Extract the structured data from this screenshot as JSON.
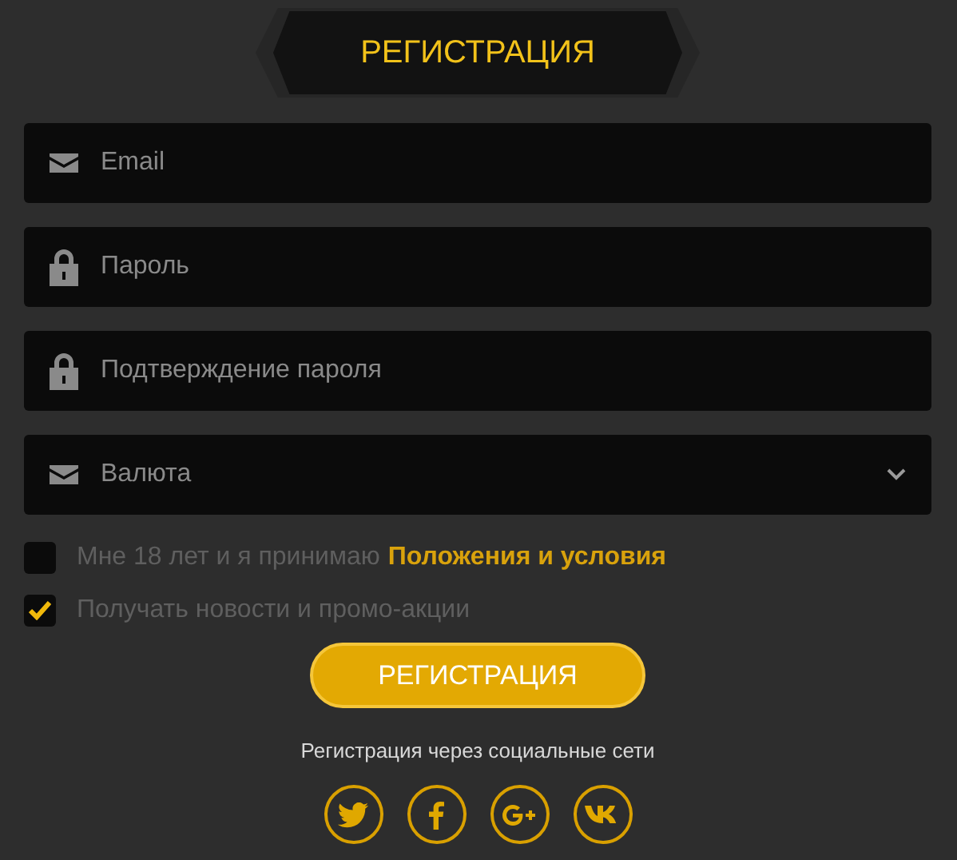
{
  "header": {
    "title": "РЕГИСТРАЦИЯ"
  },
  "fields": [
    {
      "kind": "email",
      "placeholder": "Email"
    },
    {
      "kind": "password",
      "placeholder": "Пароль"
    },
    {
      "kind": "password",
      "placeholder": "Подтверждение пароля"
    },
    {
      "kind": "currency",
      "placeholder": "Валюта"
    }
  ],
  "checkboxes": [
    {
      "label": "Мне 18 лет и я принимаю",
      "link": "Положения и условия",
      "checked": false
    },
    {
      "label": "Получать новости и промо-акции",
      "checked": true
    }
  ],
  "submit": "РЕГИСТРАЦИЯ",
  "social": {
    "caption": "Регистрация через социальные сети",
    "networks": [
      {
        "kind": "twitter"
      },
      {
        "kind": "facebook"
      },
      {
        "kind": "googleplus"
      },
      {
        "kind": "vk"
      }
    ]
  }
}
